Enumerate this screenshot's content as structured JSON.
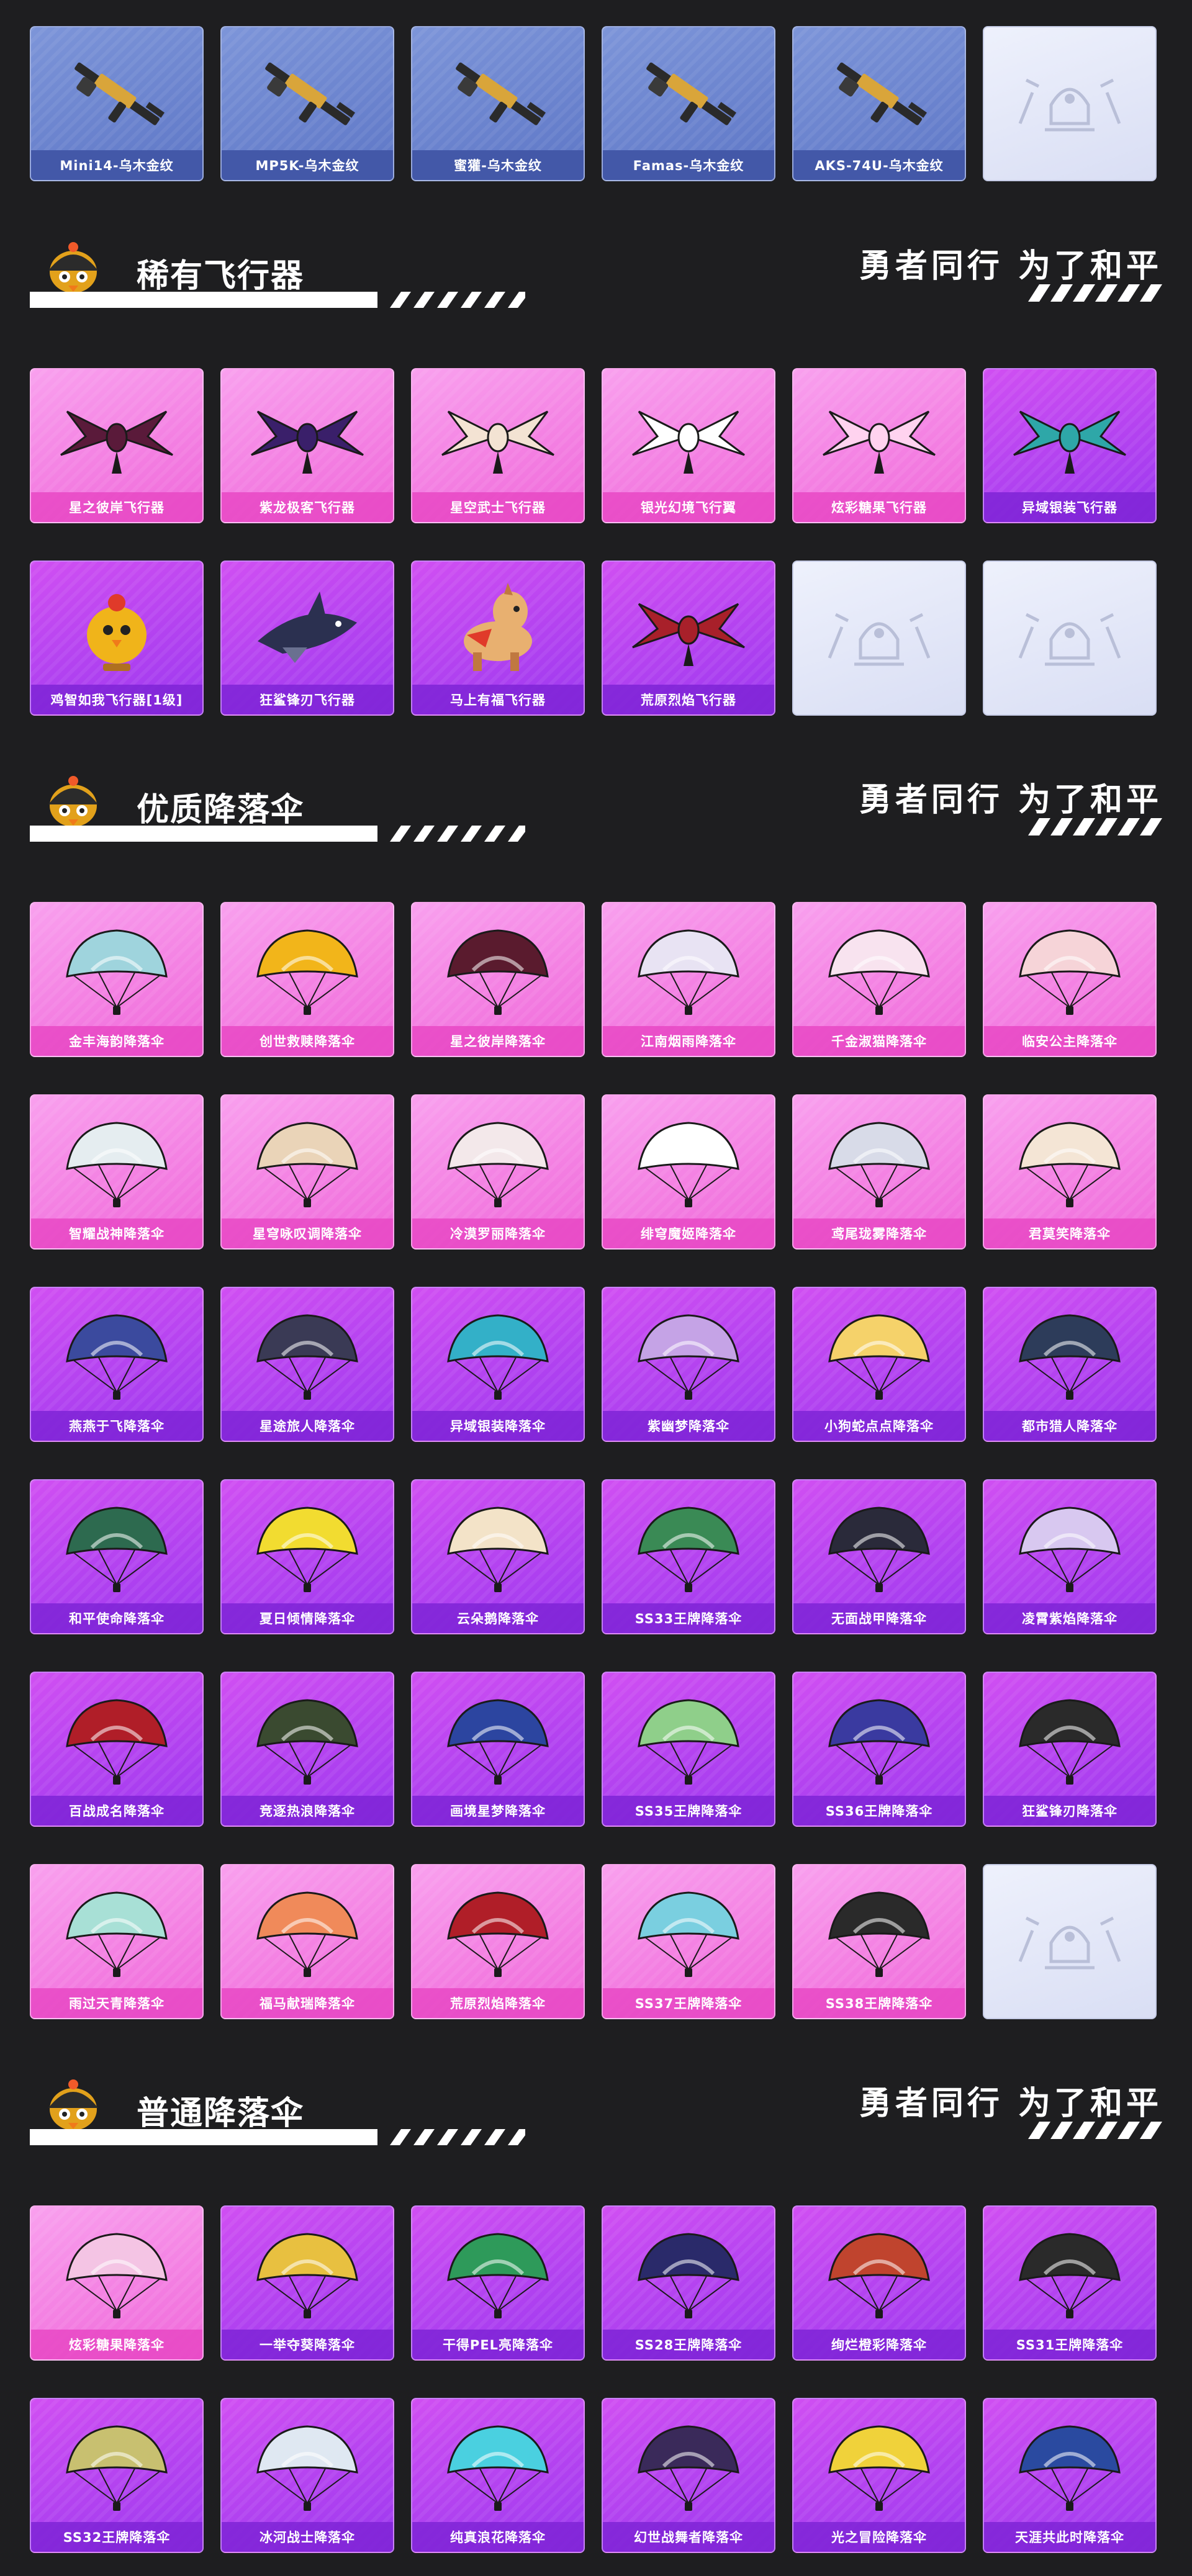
{
  "slogan": "勇者同行 为了和平",
  "sections": {
    "guns": {
      "items": [
        {
          "label": "Mini14-乌木金纹",
          "style": "blue",
          "icon": "rifle-icon"
        },
        {
          "label": "MP5K-乌木金纹",
          "style": "blue",
          "icon": "smg-icon"
        },
        {
          "label": "蜜獾-乌木金纹",
          "style": "blue",
          "icon": "smg-icon"
        },
        {
          "label": "Famas-乌木金纹",
          "style": "blue",
          "icon": "rifle-icon"
        },
        {
          "label": "AKS-74U-乌木金纹",
          "style": "blue",
          "icon": "rifle-icon"
        },
        {
          "label": "",
          "style": "empty",
          "icon": "emblem-placeholder-icon"
        }
      ]
    },
    "gliders": {
      "title": "稀有飞行器",
      "items": [
        {
          "label": "星之彼岸飞行器",
          "style": "pink",
          "icon": "glider-icon",
          "color": "#5a1a3a"
        },
        {
          "label": "紫龙极客飞行器",
          "style": "pink",
          "icon": "glider-icon",
          "color": "#3a1f6a"
        },
        {
          "label": "星空武士飞行器",
          "style": "pink",
          "icon": "glider-icon",
          "color": "#f3e3d3"
        },
        {
          "label": "银光幻境飞行翼",
          "style": "pink",
          "icon": "glider-icon",
          "color": "#ffffff"
        },
        {
          "label": "炫彩糖果飞行器",
          "style": "pink",
          "icon": "glider-icon",
          "color": "#ffd3ef"
        },
        {
          "label": "异域银装飞行器",
          "style": "purple",
          "icon": "glider-icon",
          "color": "#2ea7a8"
        },
        {
          "label": "鸡智如我飞行器[1级]",
          "style": "purple",
          "icon": "chicken-glider-icon",
          "color": "#f0b41a"
        },
        {
          "label": "狂鲨锋刃飞行器",
          "style": "purple",
          "icon": "shark-glider-icon",
          "color": "#2b3050"
        },
        {
          "label": "马上有福飞行器",
          "style": "purple",
          "icon": "horse-glider-icon",
          "color": "#e8b070"
        },
        {
          "label": "荒原烈焰飞行器",
          "style": "purple",
          "icon": "glider-icon",
          "color": "#a8202a"
        },
        {
          "label": "",
          "style": "empty",
          "icon": "emblem-placeholder-icon"
        },
        {
          "label": "",
          "style": "empty",
          "icon": "emblem-placeholder-icon"
        }
      ]
    },
    "premium": {
      "title": "优质降落伞",
      "items": [
        {
          "label": "金丰海韵降落伞",
          "style": "pink",
          "icon": "parachute-icon",
          "color": "#9fd4dd"
        },
        {
          "label": "创世救赎降落伞",
          "style": "pink",
          "icon": "parachute-icon",
          "color": "#f2b51a"
        },
        {
          "label": "星之彼岸降落伞",
          "style": "pink",
          "icon": "parachute-icon",
          "color": "#5a1b2e"
        },
        {
          "label": "江南烟雨降落伞",
          "style": "pink",
          "icon": "parachute-icon",
          "color": "#e8e3f3"
        },
        {
          "label": "千金淑猫降落伞",
          "style": "pink",
          "icon": "parachute-icon",
          "color": "#f8e3ef"
        },
        {
          "label": "临安公主降落伞",
          "style": "pink",
          "icon": "parachute-icon",
          "color": "#f6d4d8"
        },
        {
          "label": "智耀战神降落伞",
          "style": "pink",
          "icon": "parachute-icon",
          "color": "#e5edf0"
        },
        {
          "label": "星穹咏叹调降落伞",
          "style": "pink",
          "icon": "parachute-icon",
          "color": "#ead4b8"
        },
        {
          "label": "冷漠罗丽降落伞",
          "style": "pink",
          "icon": "parachute-icon",
          "color": "#f3e8ea"
        },
        {
          "label": "绯穹魔姬降落伞",
          "style": "pink",
          "icon": "parachute-icon",
          "color": "#ffffff"
        },
        {
          "label": "鸢尾珑雾降落伞",
          "style": "pink",
          "icon": "parachute-icon",
          "color": "#d8dbe8"
        },
        {
          "label": "君莫笑降落伞",
          "style": "pink",
          "icon": "parachute-icon",
          "color": "#f4e5d5"
        },
        {
          "label": "燕燕于飞降落伞",
          "style": "purple",
          "icon": "parachute-icon",
          "color": "#3b4a9e"
        },
        {
          "label": "星途旅人降落伞",
          "style": "purple",
          "icon": "parachute-icon",
          "color": "#3a3a55"
        },
        {
          "label": "异域银装降落伞",
          "style": "purple",
          "icon": "parachute-icon",
          "color": "#33b0c8"
        },
        {
          "label": "紫幽梦降落伞",
          "style": "purple",
          "icon": "parachute-icon",
          "color": "#c5a3e6"
        },
        {
          "label": "小狗蛇点点降落伞",
          "style": "purple",
          "icon": "parachute-icon",
          "color": "#f5d26a"
        },
        {
          "label": "都市猎人降落伞",
          "style": "purple",
          "icon": "parachute-icon",
          "color": "#2d3c5a"
        },
        {
          "label": "和平使命降落伞",
          "style": "purple",
          "icon": "parachute-icon",
          "color": "#2d6a4f"
        },
        {
          "label": "夏日倾情降落伞",
          "style": "purple",
          "icon": "parachute-icon",
          "color": "#f2dc30"
        },
        {
          "label": "云朵鹅降落伞",
          "style": "purple",
          "icon": "parachute-icon",
          "color": "#f3e3c8"
        },
        {
          "label": "SS33王牌降落伞",
          "style": "purple",
          "icon": "parachute-icon",
          "color": "#3a8a55"
        },
        {
          "label": "无面战甲降落伞",
          "style": "purple",
          "icon": "parachute-icon",
          "color": "#2a2a3a"
        },
        {
          "label": "凌霄紫焰降落伞",
          "style": "purple",
          "icon": "parachute-icon",
          "color": "#d8c8f0"
        },
        {
          "label": "百战成名降落伞",
          "style": "purple",
          "icon": "parachute-icon",
          "color": "#b01e28"
        },
        {
          "label": "竞逐热浪降落伞",
          "style": "purple",
          "icon": "parachute-icon",
          "color": "#3a4a30"
        },
        {
          "label": "画境星梦降落伞",
          "style": "purple",
          "icon": "parachute-icon",
          "color": "#2c45a0"
        },
        {
          "label": "SS35王牌降落伞",
          "style": "purple",
          "icon": "parachute-icon",
          "color": "#8fcf8a"
        },
        {
          "label": "SS36王牌降落伞",
          "style": "purple",
          "icon": "parachute-icon",
          "color": "#3a3aa0"
        },
        {
          "label": "狂鲨锋刃降落伞",
          "style": "purple",
          "icon": "parachute-icon",
          "color": "#2a2a2a"
        },
        {
          "label": "雨过天青降落伞",
          "style": "pink",
          "icon": "parachute-icon",
          "color": "#a8e0d6"
        },
        {
          "label": "福马献瑞降落伞",
          "style": "pink",
          "icon": "parachute-icon",
          "color": "#f08a5a"
        },
        {
          "label": "荒原烈焰降落伞",
          "style": "pink",
          "icon": "parachute-icon",
          "color": "#b01e28"
        },
        {
          "label": "SS37王牌降落伞",
          "style": "pink",
          "icon": "parachute-icon",
          "color": "#7acfe0"
        },
        {
          "label": "SS38王牌降落伞",
          "style": "pink",
          "icon": "parachute-icon",
          "color": "#2a2a2a"
        },
        {
          "label": "",
          "style": "empty",
          "icon": "emblem-placeholder-icon"
        }
      ]
    },
    "common": {
      "title": "普通降落伞",
      "items": [
        {
          "label": "炫彩糖果降落伞",
          "style": "pink",
          "icon": "parachute-icon",
          "color": "#f4c4e4"
        },
        {
          "label": "一举夺葵降落伞",
          "style": "purple",
          "icon": "parachute-icon",
          "color": "#e8c040"
        },
        {
          "label": "干得PEL亮降落伞",
          "style": "purple",
          "icon": "parachute-icon",
          "color": "#2e9a5a"
        },
        {
          "label": "SS28王牌降落伞",
          "style": "purple",
          "icon": "parachute-icon",
          "color": "#2a2a6a"
        },
        {
          "label": "绚烂橙彩降落伞",
          "style": "purple",
          "icon": "parachute-icon",
          "color": "#c0442e"
        },
        {
          "label": "SS31王牌降落伞",
          "style": "purple",
          "icon": "parachute-icon",
          "color": "#2a2a2a"
        },
        {
          "label": "SS32王牌降落伞",
          "style": "purple",
          "icon": "parachute-icon",
          "color": "#c8c070"
        },
        {
          "label": "冰河战士降落伞",
          "style": "purple",
          "icon": "parachute-icon",
          "color": "#dfe8f2"
        },
        {
          "label": "纯真浪花降落伞",
          "style": "purple",
          "icon": "parachute-icon",
          "color": "#4ad0e0"
        },
        {
          "label": "幻世战舞者降落伞",
          "style": "purple",
          "icon": "parachute-icon",
          "color": "#3a2a5a"
        },
        {
          "label": "光之冒险降落伞",
          "style": "purple",
          "icon": "parachute-icon",
          "color": "#f0d23a"
        },
        {
          "label": "天涯共此时降落伞",
          "style": "purple",
          "icon": "parachute-icon",
          "color": "#2a4aa0"
        }
      ]
    }
  }
}
